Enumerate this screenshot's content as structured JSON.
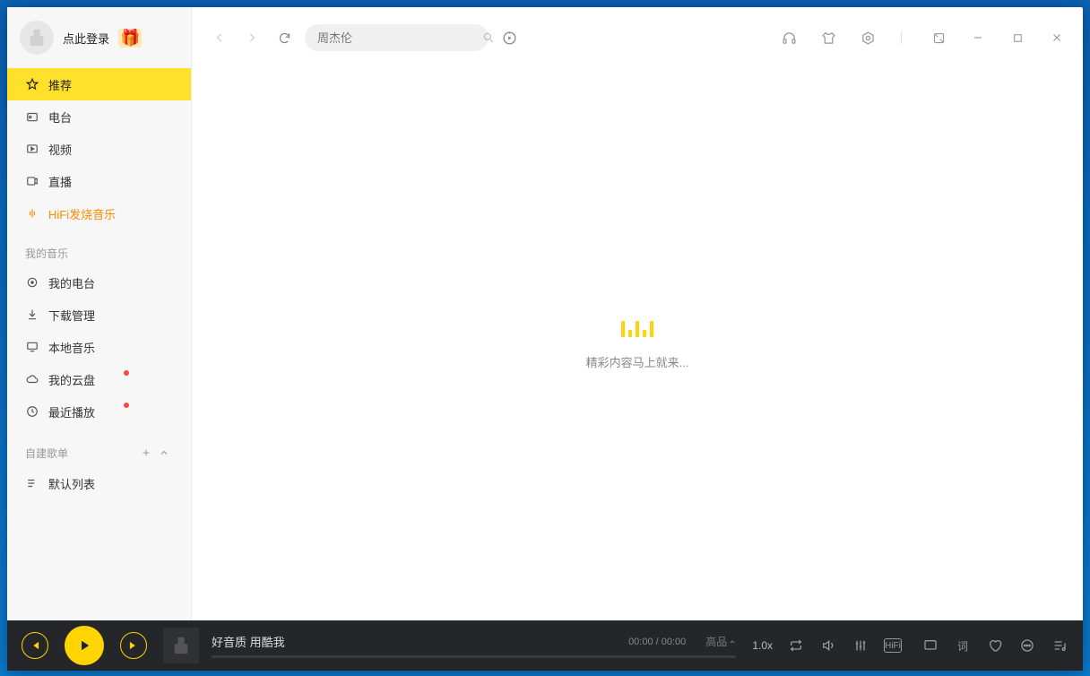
{
  "login": {
    "text": "点此登录"
  },
  "nav": [
    {
      "label": "推荐",
      "active": true
    },
    {
      "label": "电台"
    },
    {
      "label": "视频"
    },
    {
      "label": "直播"
    },
    {
      "label": "HiFi发烧音乐",
      "hifi": true
    }
  ],
  "myMusic": {
    "title": "我的音乐"
  },
  "myItems": [
    {
      "label": "我的电台",
      "dot": false
    },
    {
      "label": "下载管理",
      "dot": false
    },
    {
      "label": "本地音乐",
      "dot": false
    },
    {
      "label": "我的云盘",
      "dot": true
    },
    {
      "label": "最近播放",
      "dot": true
    }
  ],
  "playlist": {
    "title": "自建歌单"
  },
  "playlistItems": [
    {
      "label": "默认列表"
    }
  ],
  "search": {
    "placeholder": "周杰伦"
  },
  "loading": {
    "text": "精彩内容马上就来..."
  },
  "player": {
    "title": "好音质 用酷我",
    "current": "00:00",
    "separator": " / ",
    "total": "00:00",
    "speed": "1.0x",
    "quality": "高品",
    "hifi": "HiFi"
  }
}
